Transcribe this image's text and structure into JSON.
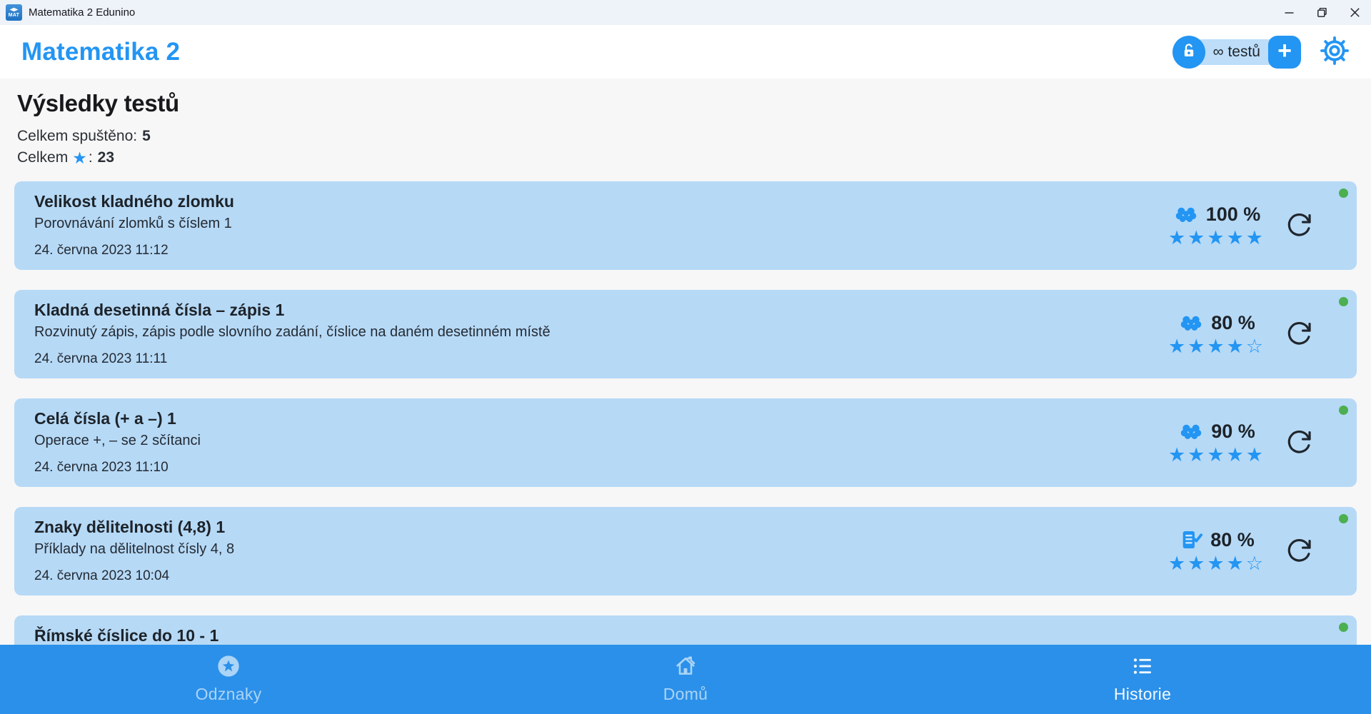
{
  "titlebar": {
    "app_icon_text": "MAT",
    "title": "Matematika 2 Edunino",
    "buttons": [
      "minimize",
      "restore",
      "close"
    ]
  },
  "header": {
    "brand": "Matematika 2",
    "license_badge": "∞ testů",
    "plus_label": "+"
  },
  "page": {
    "heading": "Výsledky testů",
    "stat_started_label": "Celkem spuštěno:",
    "stat_started_value": "5",
    "stat_stars_label": "Celkem",
    "stat_stars_colon": ":",
    "stat_stars_value": "23",
    "star_glyph": "★"
  },
  "tests": [
    {
      "title": "Velikost kladného zlomku",
      "subtitle": "Porovnávání zlomků s číslem 1",
      "date": "24. června 2023 11:12",
      "icon": "brain-icon",
      "score": "100 %",
      "stars_filled": 5,
      "stars_total": 5,
      "status_dot": true
    },
    {
      "title": "Kladná desetinná čísla – zápis 1",
      "subtitle": "Rozvinutý zápis, zápis podle slovního zadání, číslice na daném desetinném místě",
      "date": "24. června 2023 11:11",
      "icon": "brain-icon",
      "score": "80 %",
      "stars_filled": 4,
      "stars_total": 5,
      "status_dot": true
    },
    {
      "title": "Celá čísla (+ a –) 1",
      "subtitle": "Operace +, – se 2 sčítanci",
      "date": "24. června 2023 11:10",
      "icon": "brain-icon",
      "score": "90 %",
      "stars_filled": 5,
      "stars_total": 5,
      "status_dot": true
    },
    {
      "title": "Znaky dělitelnosti (4,8) 1",
      "subtitle": "Příklady na dělitelnost čísly 4, 8",
      "date": "24. června 2023 10:04",
      "icon": "test-check-icon",
      "score": "80 %",
      "stars_filled": 4,
      "stars_total": 5,
      "status_dot": true
    },
    {
      "title": "Římské číslice do 10 - 1",
      "subtitle": "",
      "date": "",
      "icon": null,
      "score": null,
      "stars_filled": null,
      "stars_total": null,
      "status_dot": true
    }
  ],
  "nav": {
    "items": [
      {
        "label": "Odznaky",
        "icon": "badge-star-icon",
        "active": false
      },
      {
        "label": "Domů",
        "icon": "home-icon",
        "active": false
      },
      {
        "label": "Historie",
        "icon": "list-icon",
        "active": true
      }
    ]
  },
  "colors": {
    "accent_blue": "#2395f3",
    "card_background": "#b6d9f6",
    "nav_background": "#2b90e9",
    "status_green": "#4caf50",
    "titlebar_background": "#eef2f9"
  }
}
